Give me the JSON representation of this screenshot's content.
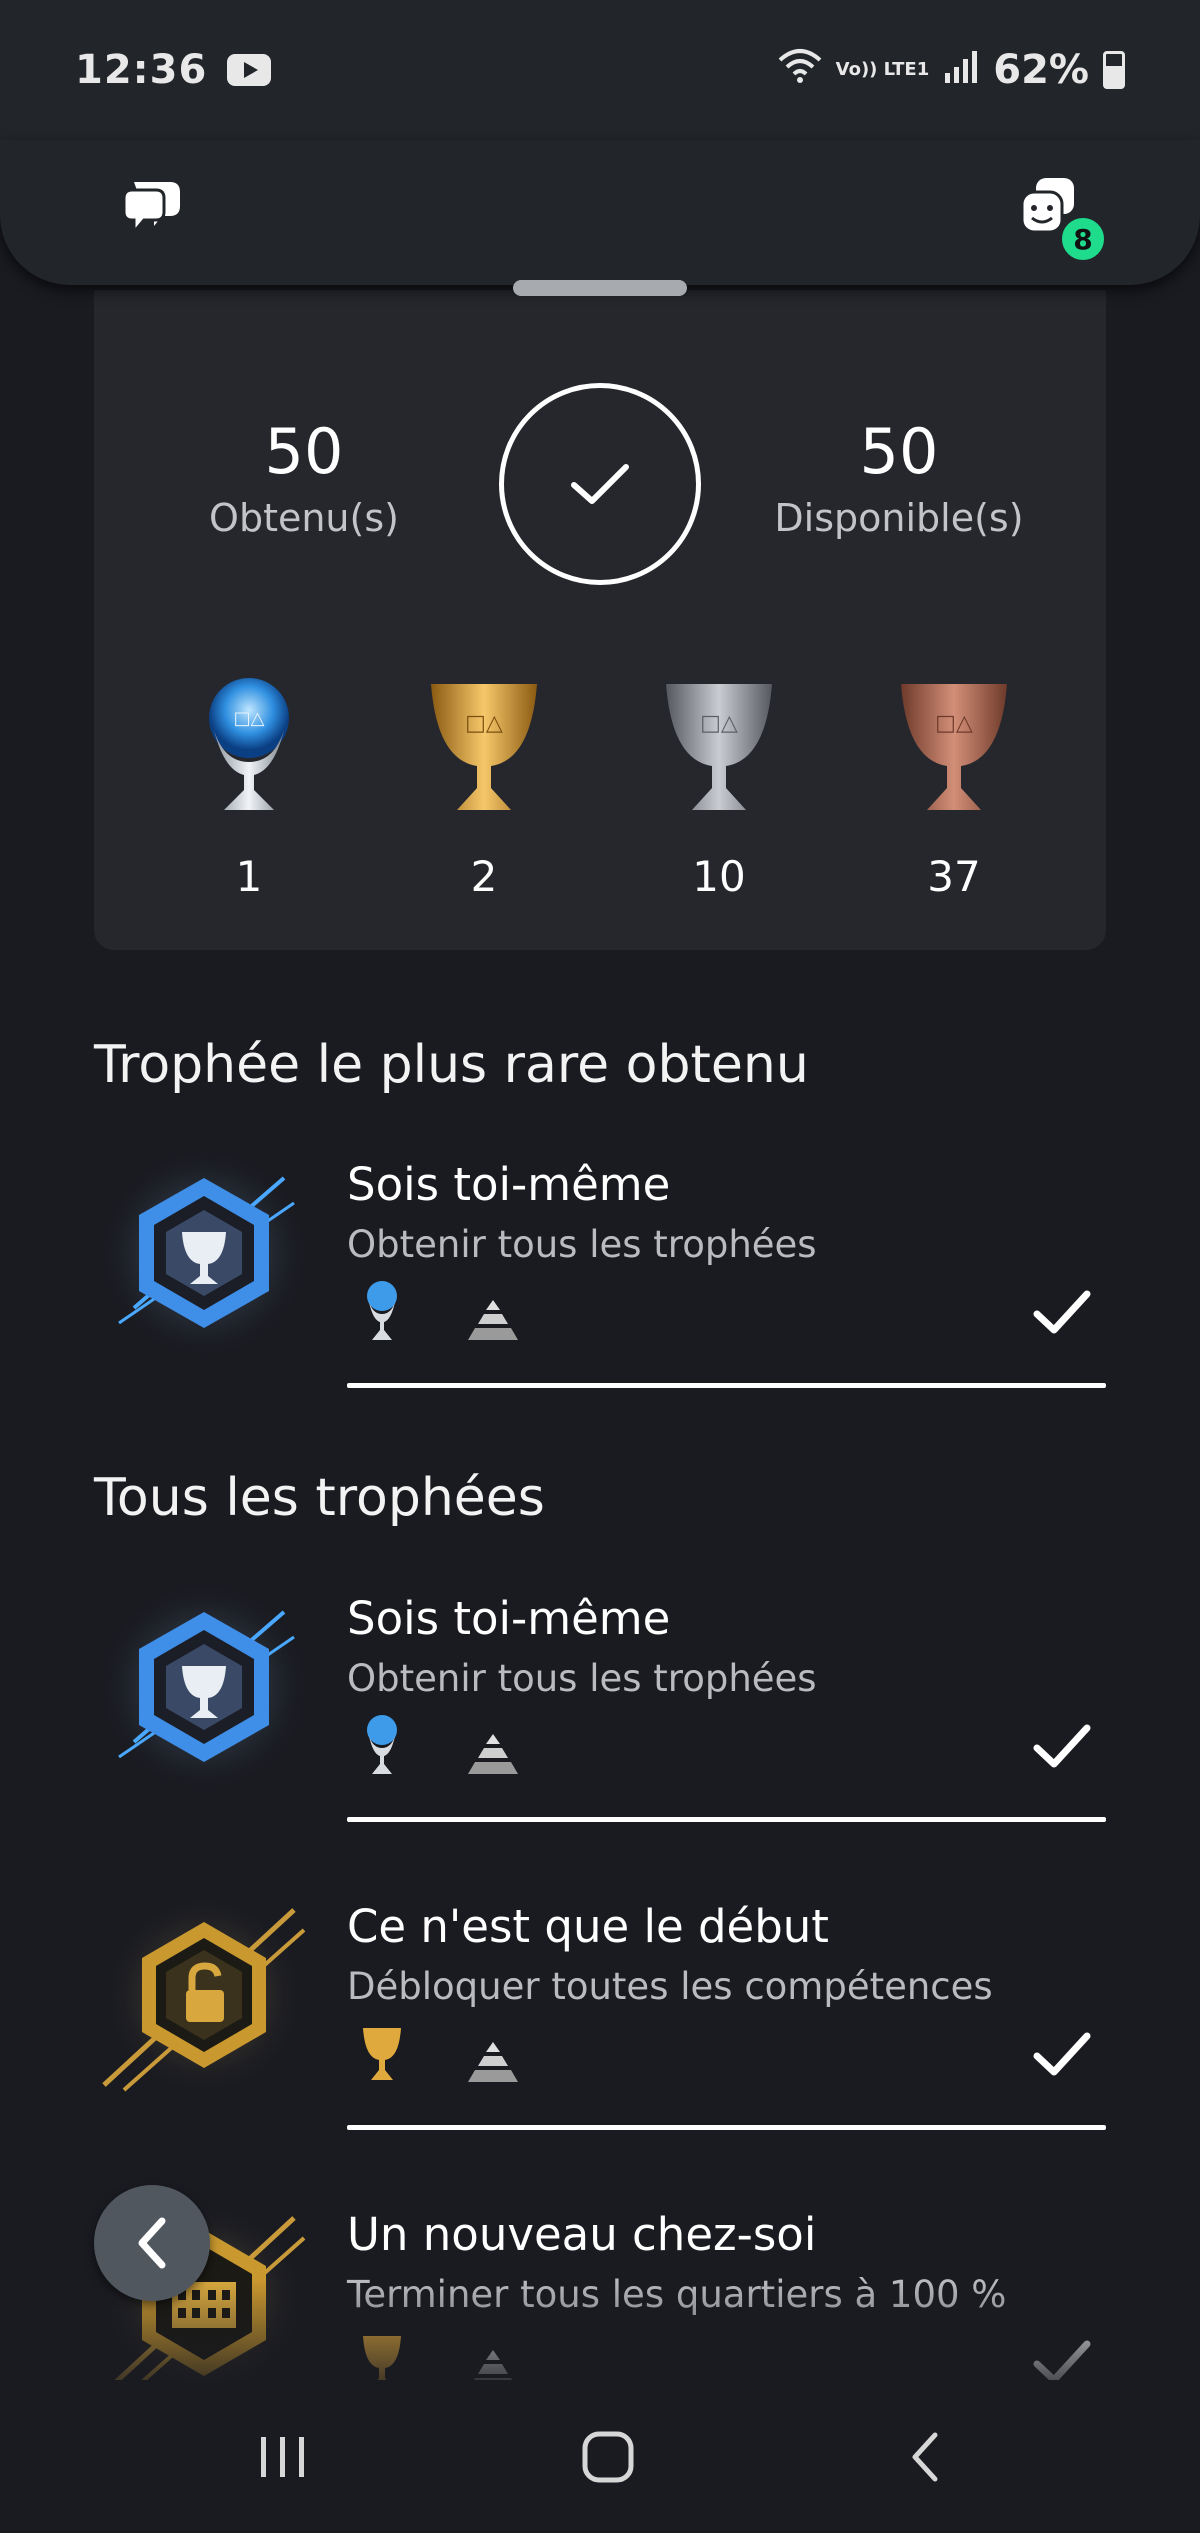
{
  "status_bar": {
    "time": "12:36",
    "battery": "62%",
    "network": "Vo)) LTE1"
  },
  "header": {
    "notification_count": "8"
  },
  "summary": {
    "obtained_value": "50",
    "obtained_label": "Obtenu(s)",
    "available_value": "50",
    "available_label": "Disponible(s)",
    "trophy_counts": {
      "platinum": "1",
      "gold": "2",
      "silver": "10",
      "bronze": "37"
    }
  },
  "rarest": {
    "section_title": "Trophée le plus rare obtenu",
    "trophy": {
      "title": "Sois toi-même",
      "description": "Obtenir tous les trophées",
      "type": "platinum",
      "earned": true
    }
  },
  "all": {
    "section_title": "Tous les trophées",
    "trophies": [
      {
        "title": "Sois toi-même",
        "description": "Obtenir tous les trophées",
        "type": "platinum",
        "earned": true
      },
      {
        "title": "Ce n'est que le début",
        "description": "Débloquer toutes les compétences",
        "type": "gold",
        "earned": true
      },
      {
        "title": "Un nouveau chez-soi",
        "description": "Terminer tous les quartiers à 100 %",
        "type": "gold",
        "earned": true
      }
    ]
  },
  "colors": {
    "background": "#1a1b21",
    "card": "#25272d",
    "badge": "#1fdc8d",
    "fab": "#50575f"
  }
}
